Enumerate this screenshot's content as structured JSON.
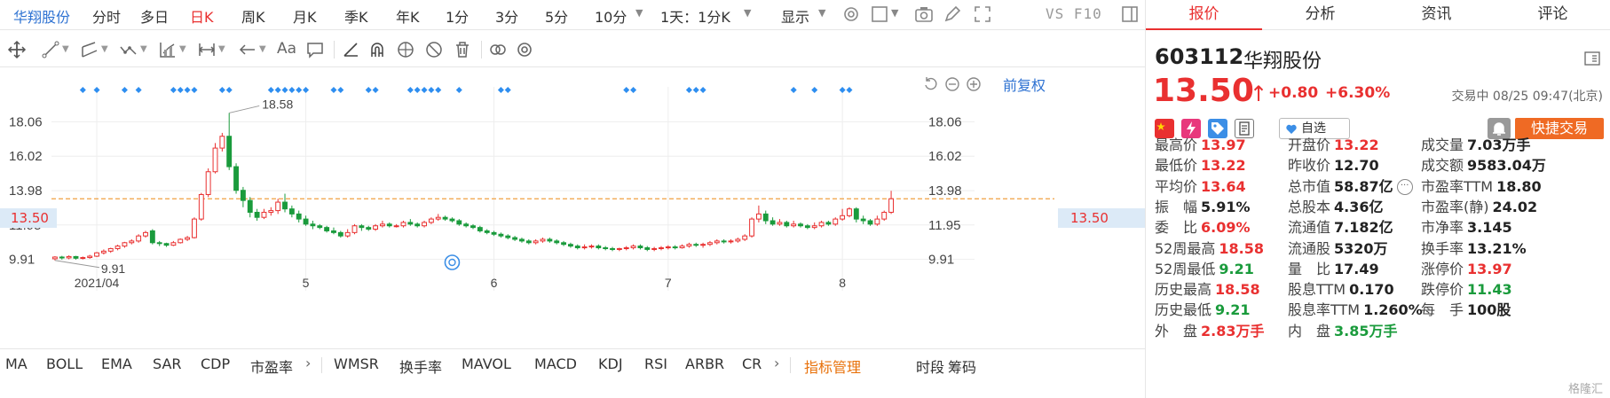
{
  "topbar": {
    "stock_name": "华翔股份",
    "periods": [
      "分时",
      "多日",
      "日K",
      "周K",
      "月K",
      "季K",
      "年K",
      "1分",
      "3分",
      "5分",
      "10分"
    ],
    "active_period": "日K",
    "interval_select": "1天：1分K",
    "display_label": "显示",
    "vs_label": "VS F10"
  },
  "chart": {
    "adjust_label": "前复权",
    "max_label": "18.58",
    "min_label": "9.91",
    "last_price_label": "13.50",
    "y_ticks": [
      "18.06",
      "16.02",
      "13.98",
      "11.95",
      "9.91"
    ],
    "x_ticks": [
      "2021/04",
      "5",
      "6",
      "7",
      "8"
    ],
    "colors": {
      "up": "#e93030",
      "down": "#1a9b3c",
      "marker": "#2e8ef0",
      "price_line": "#f0a040"
    }
  },
  "chart_data": {
    "type": "candlestick",
    "x_ticks": [
      "2021/04",
      "5",
      "6",
      "7",
      "8"
    ],
    "y_ticks": [
      18.06,
      16.02,
      13.98,
      11.95,
      9.91
    ],
    "ylim": [
      9.0,
      19.6
    ],
    "last_price": 13.5,
    "high_label": 18.58,
    "low_label": 9.91,
    "grid": true,
    "candles": [
      [
        9.95,
        10.05,
        9.85,
        10.1
      ],
      [
        10.05,
        10.0,
        9.9,
        10.12
      ],
      [
        10.0,
        10.08,
        9.92,
        10.15
      ],
      [
        10.08,
        9.98,
        9.9,
        10.12
      ],
      [
        9.98,
        10.02,
        9.91,
        10.08
      ],
      [
        10.02,
        10.1,
        9.95,
        10.18
      ],
      [
        10.1,
        10.3,
        10.05,
        10.35
      ],
      [
        10.3,
        10.4,
        10.2,
        10.5
      ],
      [
        10.4,
        10.55,
        10.3,
        10.6
      ],
      [
        10.55,
        10.7,
        10.45,
        10.78
      ],
      [
        10.7,
        10.9,
        10.6,
        10.95
      ],
      [
        10.9,
        11.0,
        10.8,
        11.1
      ],
      [
        11.0,
        11.3,
        10.9,
        11.4
      ],
      [
        11.3,
        11.5,
        11.2,
        11.6
      ],
      [
        11.6,
        10.9,
        10.8,
        11.7
      ],
      [
        10.9,
        10.85,
        10.7,
        11.0
      ],
      [
        10.85,
        10.75,
        10.65,
        10.9
      ],
      [
        10.75,
        10.9,
        10.7,
        11.0
      ],
      [
        10.9,
        11.1,
        10.85,
        11.15
      ],
      [
        11.1,
        11.2,
        11.0,
        11.3
      ],
      [
        11.2,
        12.3,
        11.15,
        12.4
      ],
      [
        12.3,
        13.75,
        12.2,
        13.85
      ],
      [
        13.75,
        15.1,
        13.6,
        15.3
      ],
      [
        15.1,
        16.5,
        15.0,
        16.8
      ],
      [
        16.5,
        17.2,
        16.3,
        17.4
      ],
      [
        17.2,
        15.4,
        15.2,
        18.58
      ],
      [
        15.4,
        14.0,
        13.8,
        15.6
      ],
      [
        14.0,
        13.4,
        13.0,
        14.2
      ],
      [
        13.4,
        12.7,
        12.4,
        13.6
      ],
      [
        12.7,
        12.4,
        12.2,
        12.9
      ],
      [
        12.4,
        12.7,
        12.3,
        12.9
      ],
      [
        12.7,
        12.8,
        12.5,
        13.0
      ],
      [
        12.8,
        13.3,
        12.6,
        13.5
      ],
      [
        13.3,
        12.9,
        12.7,
        13.8
      ],
      [
        12.9,
        12.6,
        12.4,
        13.1
      ],
      [
        12.6,
        12.3,
        12.1,
        12.8
      ],
      [
        12.3,
        12.0,
        11.9,
        12.5
      ],
      [
        12.0,
        11.9,
        11.7,
        12.2
      ],
      [
        11.9,
        11.8,
        11.7,
        12.0
      ],
      [
        11.8,
        11.6,
        11.5,
        11.9
      ],
      [
        11.6,
        11.5,
        11.4,
        11.8
      ],
      [
        11.5,
        11.3,
        11.2,
        11.6
      ],
      [
        11.3,
        11.5,
        11.2,
        11.7
      ],
      [
        11.5,
        11.9,
        11.4,
        12.0
      ],
      [
        11.9,
        11.8,
        11.6,
        12.0
      ],
      [
        11.8,
        11.7,
        11.6,
        11.9
      ],
      [
        11.7,
        11.9,
        11.6,
        12.0
      ],
      [
        11.9,
        12.0,
        11.8,
        12.2
      ],
      [
        12.0,
        11.9,
        11.8,
        12.1
      ],
      [
        11.9,
        11.9,
        11.8,
        12.0
      ],
      [
        11.9,
        12.1,
        11.8,
        12.2
      ],
      [
        12.1,
        12.0,
        11.9,
        12.3
      ],
      [
        12.0,
        11.9,
        11.8,
        12.1
      ],
      [
        11.9,
        12.1,
        11.8,
        12.2
      ],
      [
        12.1,
        12.3,
        12.0,
        12.4
      ],
      [
        12.3,
        12.4,
        12.2,
        12.6
      ],
      [
        12.4,
        12.3,
        12.2,
        12.5
      ],
      [
        12.3,
        12.2,
        12.1,
        12.4
      ],
      [
        12.2,
        12.0,
        11.9,
        12.3
      ],
      [
        12.0,
        11.9,
        11.8,
        12.1
      ],
      [
        11.9,
        11.8,
        11.7,
        12.0
      ],
      [
        11.8,
        11.6,
        11.5,
        11.9
      ],
      [
        11.6,
        11.5,
        11.4,
        11.7
      ],
      [
        11.5,
        11.4,
        11.3,
        11.6
      ],
      [
        11.4,
        11.3,
        11.2,
        11.5
      ],
      [
        11.3,
        11.2,
        11.1,
        11.4
      ],
      [
        11.2,
        11.1,
        11.0,
        11.3
      ],
      [
        11.1,
        11.0,
        10.9,
        11.2
      ],
      [
        11.0,
        10.9,
        10.8,
        11.1
      ],
      [
        10.9,
        11.0,
        10.8,
        11.1
      ],
      [
        11.0,
        11.1,
        10.9,
        11.2
      ],
      [
        11.1,
        11.0,
        10.9,
        11.2
      ],
      [
        11.0,
        10.9,
        10.8,
        11.1
      ],
      [
        10.9,
        10.8,
        10.7,
        11.0
      ],
      [
        10.8,
        10.7,
        10.6,
        10.9
      ],
      [
        10.7,
        10.6,
        10.5,
        10.8
      ],
      [
        10.6,
        10.65,
        10.5,
        10.8
      ],
      [
        10.65,
        10.7,
        10.55,
        10.8
      ],
      [
        10.7,
        10.6,
        10.5,
        10.8
      ],
      [
        10.6,
        10.55,
        10.45,
        10.7
      ],
      [
        10.55,
        10.5,
        10.4,
        10.65
      ],
      [
        10.5,
        10.55,
        10.4,
        10.6
      ],
      [
        10.55,
        10.6,
        10.45,
        10.7
      ],
      [
        10.6,
        10.7,
        10.5,
        10.8
      ],
      [
        10.7,
        10.6,
        10.5,
        10.8
      ],
      [
        10.6,
        10.5,
        10.4,
        10.7
      ],
      [
        10.5,
        10.55,
        10.4,
        10.65
      ],
      [
        10.55,
        10.6,
        10.45,
        10.7
      ],
      [
        10.6,
        10.65,
        10.5,
        10.75
      ],
      [
        10.65,
        10.6,
        10.5,
        10.75
      ],
      [
        10.6,
        10.7,
        10.55,
        10.8
      ],
      [
        10.7,
        10.8,
        10.6,
        10.9
      ],
      [
        10.8,
        10.75,
        10.65,
        10.9
      ],
      [
        10.75,
        10.8,
        10.6,
        10.9
      ],
      [
        10.8,
        10.9,
        10.7,
        11.0
      ],
      [
        10.9,
        11.0,
        10.8,
        11.1
      ],
      [
        11.0,
        10.95,
        10.85,
        11.1
      ],
      [
        10.95,
        11.0,
        10.85,
        11.1
      ],
      [
        11.0,
        11.1,
        10.9,
        11.2
      ],
      [
        11.1,
        11.3,
        11.0,
        11.4
      ],
      [
        11.3,
        12.3,
        11.2,
        12.4
      ],
      [
        12.3,
        12.6,
        12.1,
        13.1
      ],
      [
        12.6,
        12.2,
        12.0,
        12.8
      ],
      [
        12.2,
        12.0,
        11.9,
        12.4
      ],
      [
        12.0,
        12.1,
        11.9,
        12.3
      ],
      [
        12.1,
        11.9,
        11.8,
        12.2
      ],
      [
        11.9,
        12.0,
        11.8,
        12.2
      ],
      [
        12.0,
        11.9,
        11.8,
        12.1
      ],
      [
        11.9,
        11.8,
        11.7,
        12.0
      ],
      [
        11.8,
        11.9,
        11.7,
        12.1
      ],
      [
        11.9,
        12.1,
        11.8,
        12.2
      ],
      [
        12.1,
        12.0,
        11.9,
        12.2
      ],
      [
        12.0,
        12.3,
        11.9,
        12.4
      ],
      [
        12.3,
        12.5,
        12.2,
        12.9
      ],
      [
        12.5,
        12.9,
        12.4,
        13.0
      ],
      [
        12.9,
        12.3,
        12.1,
        13.0
      ],
      [
        12.3,
        12.2,
        12.0,
        12.5
      ],
      [
        12.2,
        12.0,
        11.9,
        12.3
      ],
      [
        12.0,
        12.3,
        11.9,
        12.5
      ],
      [
        12.3,
        12.7,
        12.2,
        12.8
      ],
      [
        12.7,
        13.5,
        12.6,
        13.97
      ]
    ]
  },
  "tools": {
    "crosshair": "crosshair-icon",
    "line": "line-tool-icon",
    "channel": "channel-tool-icon",
    "wave": "wave-tool-icon",
    "fib": "fib-tool-icon",
    "measure": "measure-tool-icon",
    "arrow": "arrow-tool-icon",
    "text": "Aa",
    "comment": "comment-icon",
    "angle": "angle-icon",
    "magnet": "magnet-icon",
    "eye": "eye-icon",
    "hide": "hide-icon",
    "delete": "trash-icon",
    "link": "link-icon",
    "settings": "gear-icon"
  },
  "indicators": {
    "group1": [
      "MA",
      "BOLL",
      "EMA",
      "SAR",
      "CDP",
      "市盈率"
    ],
    "group2": [
      "WMSR",
      "换手率",
      "MAVOL",
      "MACD",
      "KDJ",
      "RSI",
      "ARBR",
      "CR"
    ],
    "manager": "指标管理",
    "right": [
      "时段",
      "筹码"
    ]
  },
  "panel": {
    "tabs": [
      "报价",
      "分析",
      "资讯",
      "评论"
    ],
    "active_tab": "报价",
    "code": "603112",
    "name": "华翔股份",
    "price": "13.50",
    "change": "+0.80",
    "pct": "+6.30%",
    "trade_time": "交易中 08/25 09:47(北京)",
    "watch_label": "自选",
    "quick_trade": "快捷交易",
    "quotes": [
      [
        {
          "label": "最高价",
          "value": "13.97",
          "cls": "red"
        },
        {
          "label": "开盘价",
          "value": "13.22",
          "cls": "red"
        },
        {
          "label": "成交量",
          "value": "7.03万手",
          "cls": "black"
        }
      ],
      [
        {
          "label": "最低价",
          "value": "13.22",
          "cls": "red"
        },
        {
          "label": "昨收价",
          "value": "12.70",
          "cls": "black"
        },
        {
          "label": "成交额",
          "value": "9583.04万",
          "cls": "black"
        }
      ],
      [
        {
          "label": "平均价",
          "value": "13.64",
          "cls": "red"
        },
        {
          "label": "总市值",
          "value": "58.87亿",
          "cls": "black"
        },
        {
          "label": "市盈率TTM",
          "value": "18.80",
          "cls": "black"
        }
      ],
      [
        {
          "label": "振　幅",
          "value": "5.91%",
          "cls": "black"
        },
        {
          "label": "总股本",
          "value": "4.36亿",
          "cls": "black"
        },
        {
          "label": "市盈率(静)",
          "value": "24.02",
          "cls": "black"
        }
      ],
      [
        {
          "label": "委　比",
          "value": "6.09%",
          "cls": "red"
        },
        {
          "label": "流通值",
          "value": "7.182亿",
          "cls": "black"
        },
        {
          "label": "市净率",
          "value": "3.145",
          "cls": "black"
        }
      ],
      [
        {
          "label": "52周最高",
          "value": "18.58",
          "cls": "red"
        },
        {
          "label": "流通股",
          "value": "5320万",
          "cls": "black"
        },
        {
          "label": "换手率",
          "value": "13.21%",
          "cls": "black"
        }
      ],
      [
        {
          "label": "52周最低",
          "value": "9.21",
          "cls": "green"
        },
        {
          "label": "量　比",
          "value": "17.49",
          "cls": "black"
        },
        {
          "label": "涨停价",
          "value": "13.97",
          "cls": "red"
        }
      ],
      [
        {
          "label": "历史最高",
          "value": "18.58",
          "cls": "red"
        },
        {
          "label": "股息TTM",
          "value": "0.170",
          "cls": "black"
        },
        {
          "label": "跌停价",
          "value": "11.43",
          "cls": "green"
        }
      ],
      [
        {
          "label": "历史最低",
          "value": "9.21",
          "cls": "green"
        },
        {
          "label": "股息率TTM",
          "value": "1.260%",
          "cls": "black"
        },
        {
          "label": "每　手",
          "value": "100股",
          "cls": "black"
        }
      ],
      [
        {
          "label": "外　盘",
          "value": "2.83万手",
          "cls": "red"
        },
        {
          "label": "内　盘",
          "value": "3.85万手",
          "cls": "green"
        },
        {
          "label": "",
          "value": "",
          "cls": "black"
        }
      ]
    ],
    "watermark": "格隆汇"
  }
}
